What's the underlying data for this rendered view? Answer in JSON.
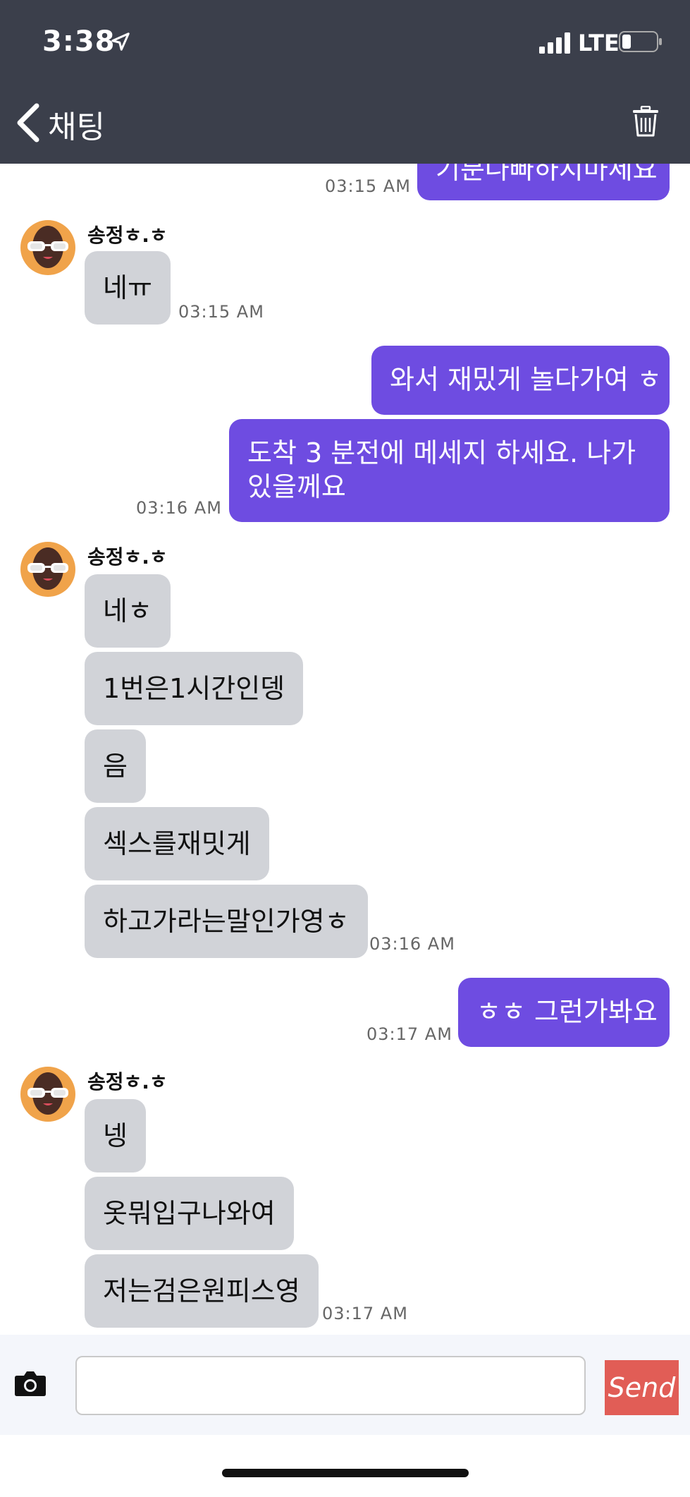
{
  "status_bar": {
    "time": "3:38",
    "network": "LTE"
  },
  "nav": {
    "back_title": "채팅"
  },
  "messages": {
    "m0_text": "기분나빠하지마세요",
    "m0_time": "03:15 AM",
    "sender1": "송정ㅎ.ㅎ",
    "m1_text": "네ㅠ",
    "m1_time": "03:15 AM",
    "m2_text": "와서 재밌게 놀다가여 ㅎ",
    "m3_text": "도착 3 분전에 메세지 하세요. 나가 있을께요",
    "m3_time": "03:16 AM",
    "sender2": "송정ㅎ.ㅎ",
    "m4_text": "네ㅎ",
    "m5_text": "1번은1시간인뎅",
    "m6_text": "음",
    "m7_text": "섹스를재밋게",
    "m8_text": "하고가라는말인가영ㅎ",
    "m8_time": "03:16 AM",
    "m9_text": "ㅎㅎ 그런가봐요",
    "m9_time": "03:17 AM",
    "sender3": "송정ㅎ.ㅎ",
    "m10_text": "넹",
    "m11_text": "옷뭐입구나와여",
    "m12_text": "저는검은원피스영",
    "m12_time": "03:17 AM"
  },
  "composer": {
    "placeholder": "",
    "send_label": "Send"
  },
  "colors": {
    "header": "#3b3f4b",
    "outgoing": "#6e4ce1",
    "incoming": "#d1d3d8",
    "send": "#e15d56"
  }
}
